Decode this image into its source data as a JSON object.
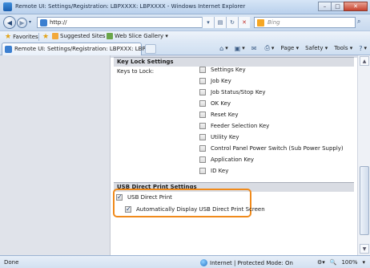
{
  "window": {
    "title": "Remote UI: Settings/Registration: LBPXXXX: LBPXXXX - Windows Internet Explorer",
    "minimize": "–",
    "maximize": "□",
    "close": "✕"
  },
  "addressbar": {
    "url": "http://",
    "search_placeholder": "Bing"
  },
  "favorites": {
    "label": "Favorites",
    "suggested": "Suggested Sites ▾",
    "gallery": "Web Slice Gallery ▾"
  },
  "tab": {
    "label": "Remote UI: Settings/Registration: LBPXXX: LBPX..."
  },
  "commandbar": {
    "page": "Page ▾",
    "safety": "Safety ▾",
    "tools": "Tools ▾"
  },
  "content": {
    "key_lock": {
      "header": "Key Lock Settings",
      "keys_label": "Keys to Lock:",
      "options": [
        {
          "label": "Settings Key",
          "checked": false
        },
        {
          "label": "Job Key",
          "checked": false
        },
        {
          "label": "Job Status/Stop Key",
          "checked": false
        },
        {
          "label": "OK Key",
          "checked": false
        },
        {
          "label": "Reset Key",
          "checked": false
        },
        {
          "label": "Feeder Selection Key",
          "checked": false
        },
        {
          "label": "Utility Key",
          "checked": false
        },
        {
          "label": "Control Panel Power Switch (Sub Power Supply)",
          "checked": false
        },
        {
          "label": "Application Key",
          "checked": false
        },
        {
          "label": "ID Key",
          "checked": false
        }
      ]
    },
    "usb_direct": {
      "header": "USB Direct Print Settings",
      "usb_direct_print": {
        "label": "USB Direct Print",
        "checked": true
      },
      "auto_display": {
        "label": "Automatically Display USB Direct Print Screen",
        "checked": true
      }
    }
  },
  "statusbar": {
    "status": "Done",
    "zone": "Internet | Protected Mode: On",
    "zoom": "100%"
  },
  "colors": {
    "highlight": "#f08a1b",
    "section_header_bg": "#d9dce3",
    "left_pane_bg": "#e0e3ea"
  }
}
